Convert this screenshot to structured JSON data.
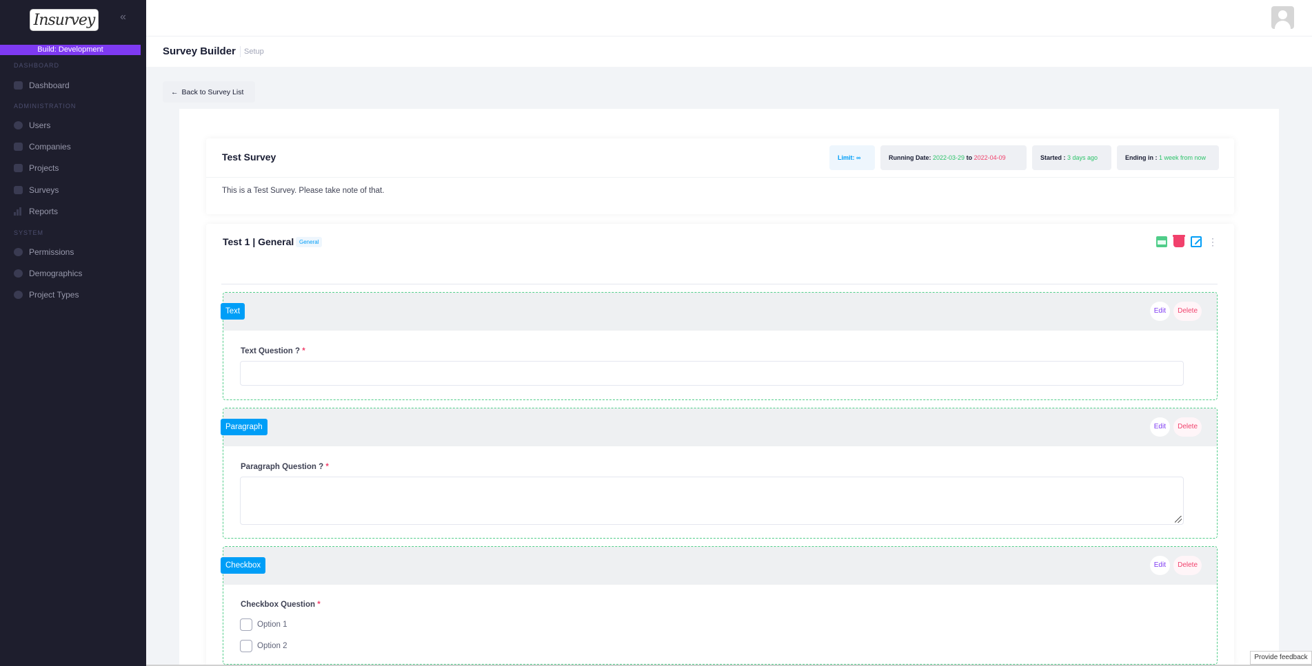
{
  "sidebar": {
    "logo_text": "Insurvey",
    "build_label": "Build: Development",
    "sections": [
      {
        "label": "DASHBOARD"
      },
      {
        "label": "ADMINISTRATION"
      },
      {
        "label": "SYSTEM"
      }
    ],
    "items": [
      {
        "label": "Dashboard",
        "icon": "dashboard-icon"
      },
      {
        "label": "Users",
        "icon": "fingerprint-icon"
      },
      {
        "label": "Companies",
        "icon": "building-icon"
      },
      {
        "label": "Projects",
        "icon": "folder-icon"
      },
      {
        "label": "Surveys",
        "icon": "survey-icon"
      },
      {
        "label": "Reports",
        "icon": "bar-chart-icon"
      },
      {
        "label": "Permissions",
        "icon": "shield-icon"
      },
      {
        "label": "Demographics",
        "icon": "globe-icon"
      },
      {
        "label": "Project Types",
        "icon": "shield-icon"
      }
    ]
  },
  "header": {
    "title": "Survey Builder",
    "subtitle": "Setup"
  },
  "back_button": "Back to Survey List",
  "survey": {
    "title": "Test Survey",
    "description": "This is a Test Survey. Please take note of that.",
    "limit_label": "Limit:",
    "limit_value": "∞",
    "running_label": "Running Date:",
    "start_date": "2022-03-29",
    "to_label": "to",
    "end_date": "2022-04-09",
    "started_label": "Started :",
    "started_value": "3 days ago",
    "ending_label": "Ending in :",
    "ending_value": "1 week from now"
  },
  "section": {
    "title": "Test 1 | General",
    "badge": "General"
  },
  "questions": [
    {
      "type": "Text",
      "label": "Text Question ?",
      "required": "*",
      "edit": "Edit",
      "delete": "Delete"
    },
    {
      "type": "Paragraph",
      "label": "Paragraph Question ?",
      "required": "*",
      "edit": "Edit",
      "delete": "Delete"
    },
    {
      "type": "Checkbox",
      "label": "Checkbox Question",
      "required": "*",
      "edit": "Edit",
      "delete": "Delete",
      "options": [
        "Option 1",
        "Option 2"
      ]
    }
  ],
  "feedback": "Provide feedback",
  "colors": {
    "sidebar_bg": "#1e1e2d",
    "build_badge": "#7e3af2",
    "primary": "#009ef7",
    "success": "#50cd89",
    "danger": "#f1416c"
  }
}
